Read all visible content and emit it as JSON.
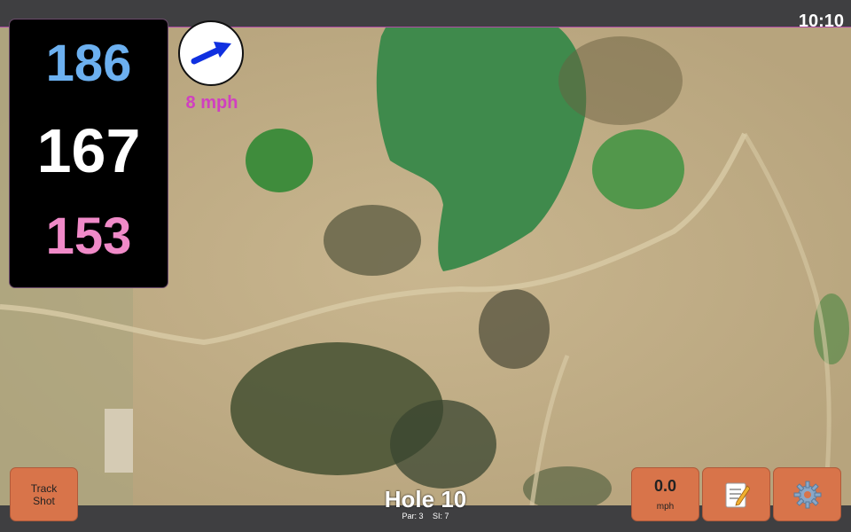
{
  "status_bar": {
    "time": "10:10"
  },
  "yardage": {
    "back": "186",
    "middle": "167",
    "front": "153"
  },
  "wind": {
    "speed_label": "8 mph",
    "direction_icon": "arrow-icon"
  },
  "hole": {
    "title": "Hole 10",
    "par": "Par: 3",
    "si": "SI: 7"
  },
  "buttons": {
    "track_shot": "Track Shot",
    "wind_value": "0.0",
    "wind_unit": "mph",
    "notes_icon": "memo-icon",
    "settings_icon": "gear-icon"
  },
  "colors": {
    "back": "#6cb0f0",
    "middle": "#ffffff",
    "front": "#f08ac8",
    "wind_arrow": "#1030e0",
    "wind_text": "#d040c0",
    "button_fill": "#d8744a"
  }
}
